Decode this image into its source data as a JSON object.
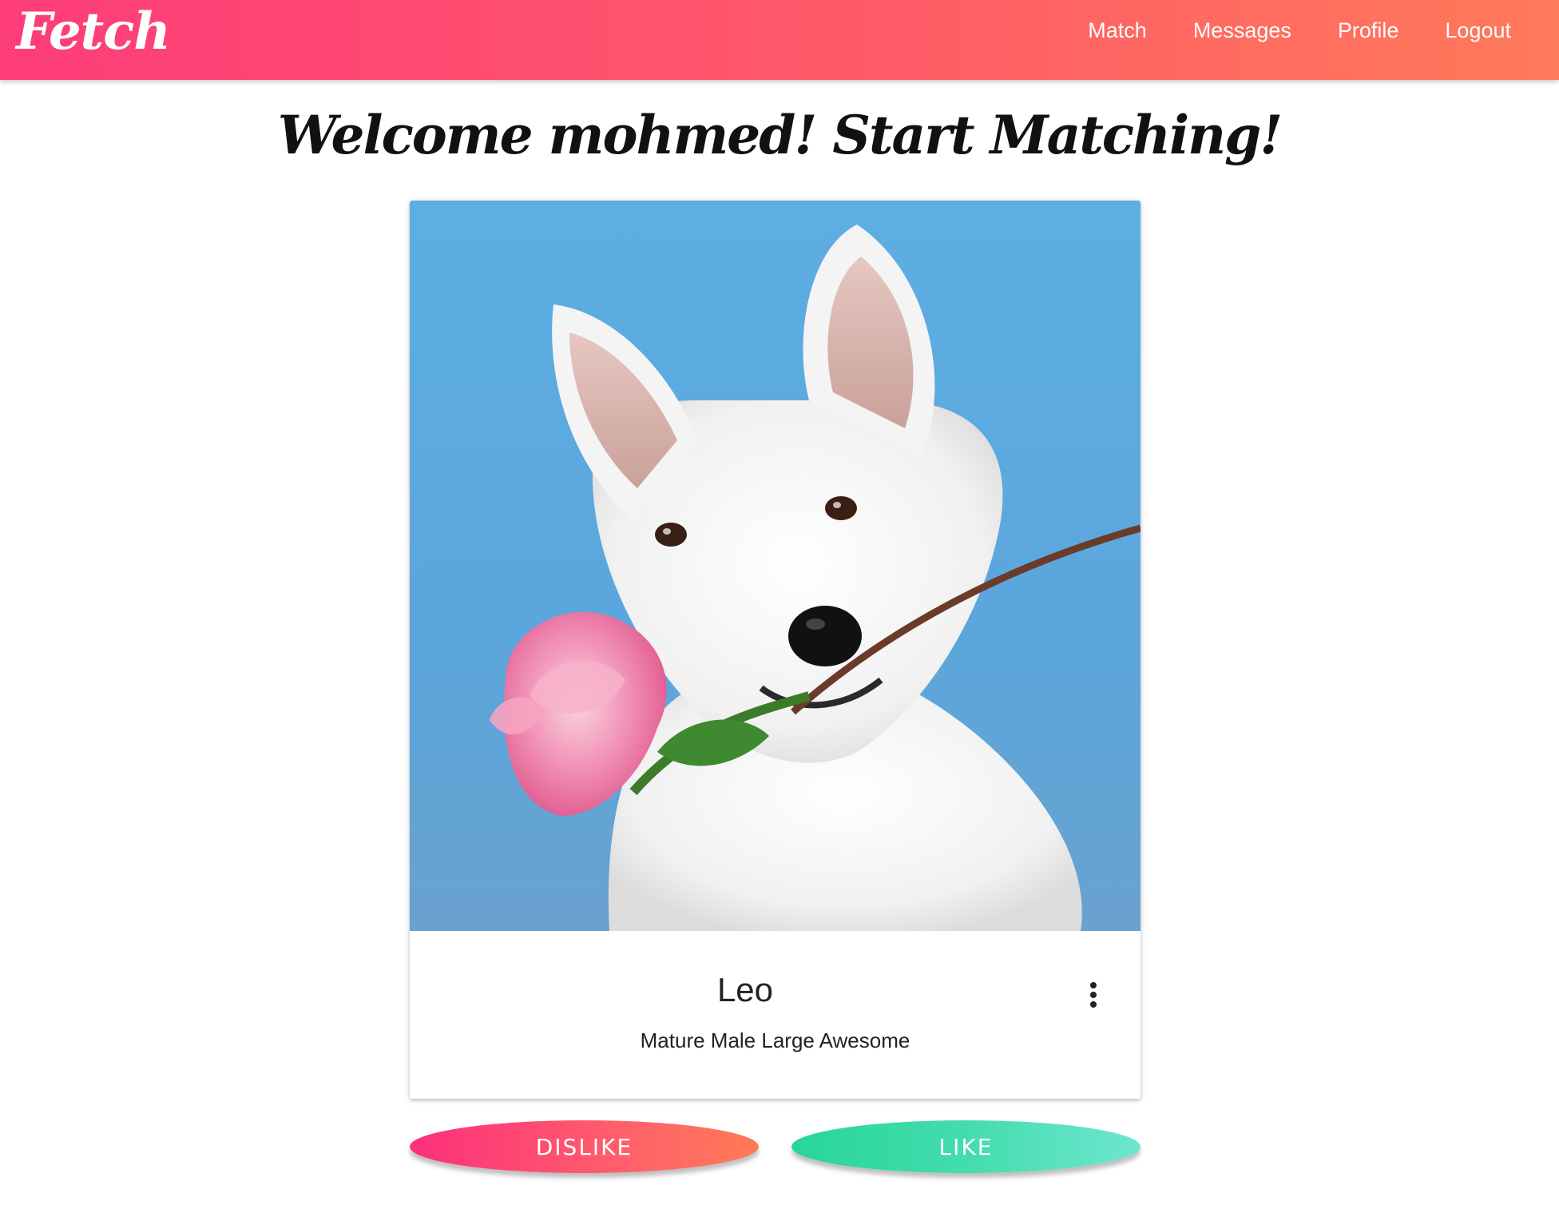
{
  "app": {
    "brand": "Fetch",
    "nav": {
      "match": "Match",
      "messages": "Messages",
      "profile": "Profile",
      "logout": "Logout"
    }
  },
  "main": {
    "welcome": "Welcome mohmed! Start Matching!"
  },
  "card": {
    "name": "Leo",
    "traits": "Mature Male Large Awesome",
    "image_subject": "white dog holding a pink rose",
    "menu_icon": "more-vert-icon"
  },
  "actions": {
    "dislike_label": "DISLIKE",
    "like_label": "LIKE"
  },
  "colors": {
    "nav_gradient_start": "#fd3c7a",
    "nav_gradient_end": "#ff7a5a",
    "dislike_start": "#fd2f7b",
    "dislike_end": "#ff7a55",
    "like_start": "#27d69a",
    "like_end": "#6ee6cf",
    "photo_background": "#5daee3"
  }
}
